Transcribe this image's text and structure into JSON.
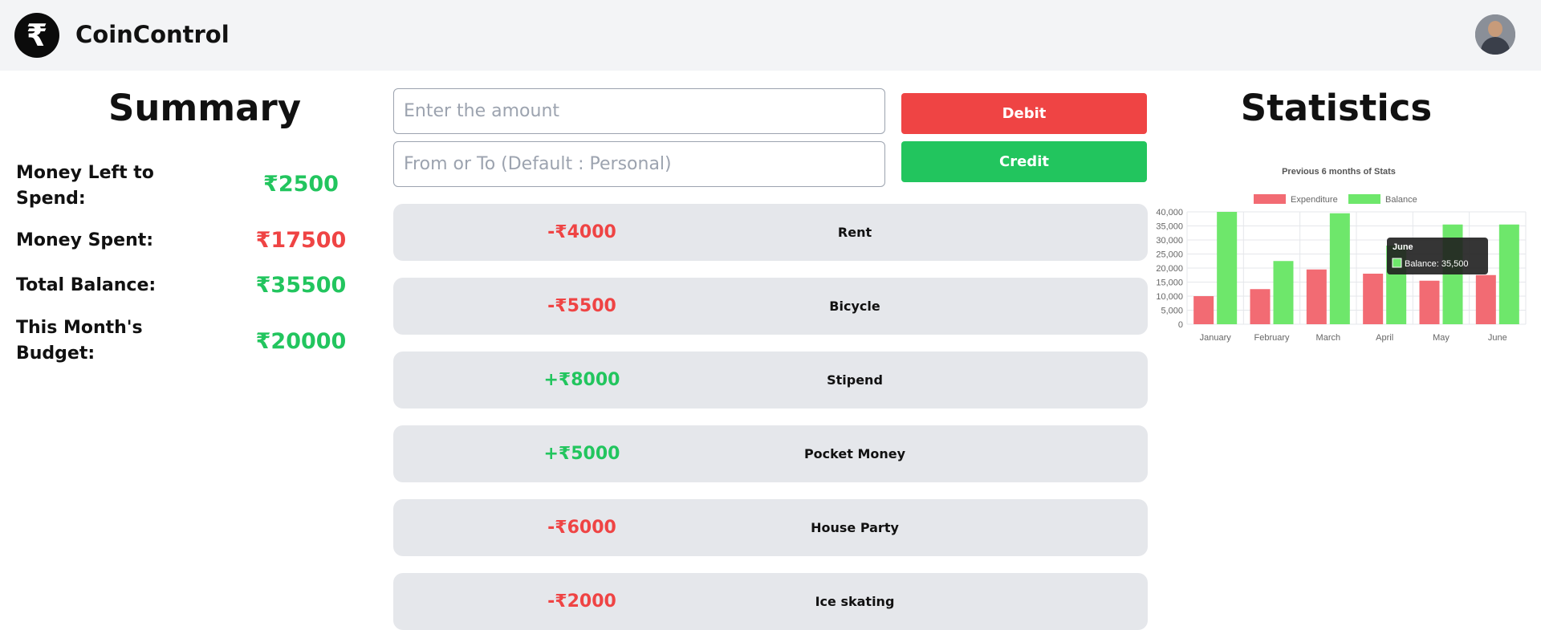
{
  "app": {
    "logo_glyph": "₹",
    "brand": "CoinControl"
  },
  "summary": {
    "title": "Summary",
    "rows": [
      {
        "label": "Money Left to Spend:",
        "value": "₹2500",
        "status": "positive"
      },
      {
        "label": "Money Spent:",
        "value": "₹17500",
        "status": "negative"
      },
      {
        "label": "Total Balance:",
        "value": "₹35500",
        "status": "positive"
      },
      {
        "label": "This Month's Budget:",
        "value": "₹20000",
        "status": "positive"
      }
    ]
  },
  "form": {
    "amount_placeholder": "Enter the amount",
    "party_placeholder": "From or To (Default : Personal)",
    "debit_label": "Debit",
    "credit_label": "Credit"
  },
  "transactions": [
    {
      "amount": "-₹4000",
      "name": "Rent",
      "type": "debit"
    },
    {
      "amount": "-₹5500",
      "name": "Bicycle",
      "type": "debit"
    },
    {
      "amount": "+₹8000",
      "name": "Stipend",
      "type": "credit"
    },
    {
      "amount": "+₹5000",
      "name": "Pocket Money",
      "type": "credit"
    },
    {
      "amount": "-₹6000",
      "name": "House Party",
      "type": "debit"
    },
    {
      "amount": "-₹2000",
      "name": "Ice skating",
      "type": "debit"
    }
  ],
  "statistics": {
    "title": "Statistics"
  },
  "colors": {
    "positive": "#22c55e",
    "negative": "#ef4444",
    "expenditure": "#f26b73",
    "balance": "#6ee76b"
  },
  "chart_data": {
    "type": "bar",
    "title": "Previous 6 months of Stats",
    "categories": [
      "January",
      "February",
      "March",
      "April",
      "May",
      "June"
    ],
    "series": [
      {
        "name": "Expenditure",
        "values": [
          10000,
          12500,
          19500,
          18000,
          15500,
          17500
        ]
      },
      {
        "name": "Balance",
        "values": [
          40000,
          22500,
          39500,
          28000,
          35500,
          35500
        ]
      }
    ],
    "ylim": [
      0,
      40000
    ],
    "yticks": [
      "0",
      "5,000",
      "10,000",
      "15,000",
      "20,000",
      "25,000",
      "30,000",
      "35,000",
      "40,000"
    ],
    "grid": true,
    "legend": "top",
    "tooltip": {
      "title": "June",
      "text": "Balance: 35,500"
    }
  }
}
